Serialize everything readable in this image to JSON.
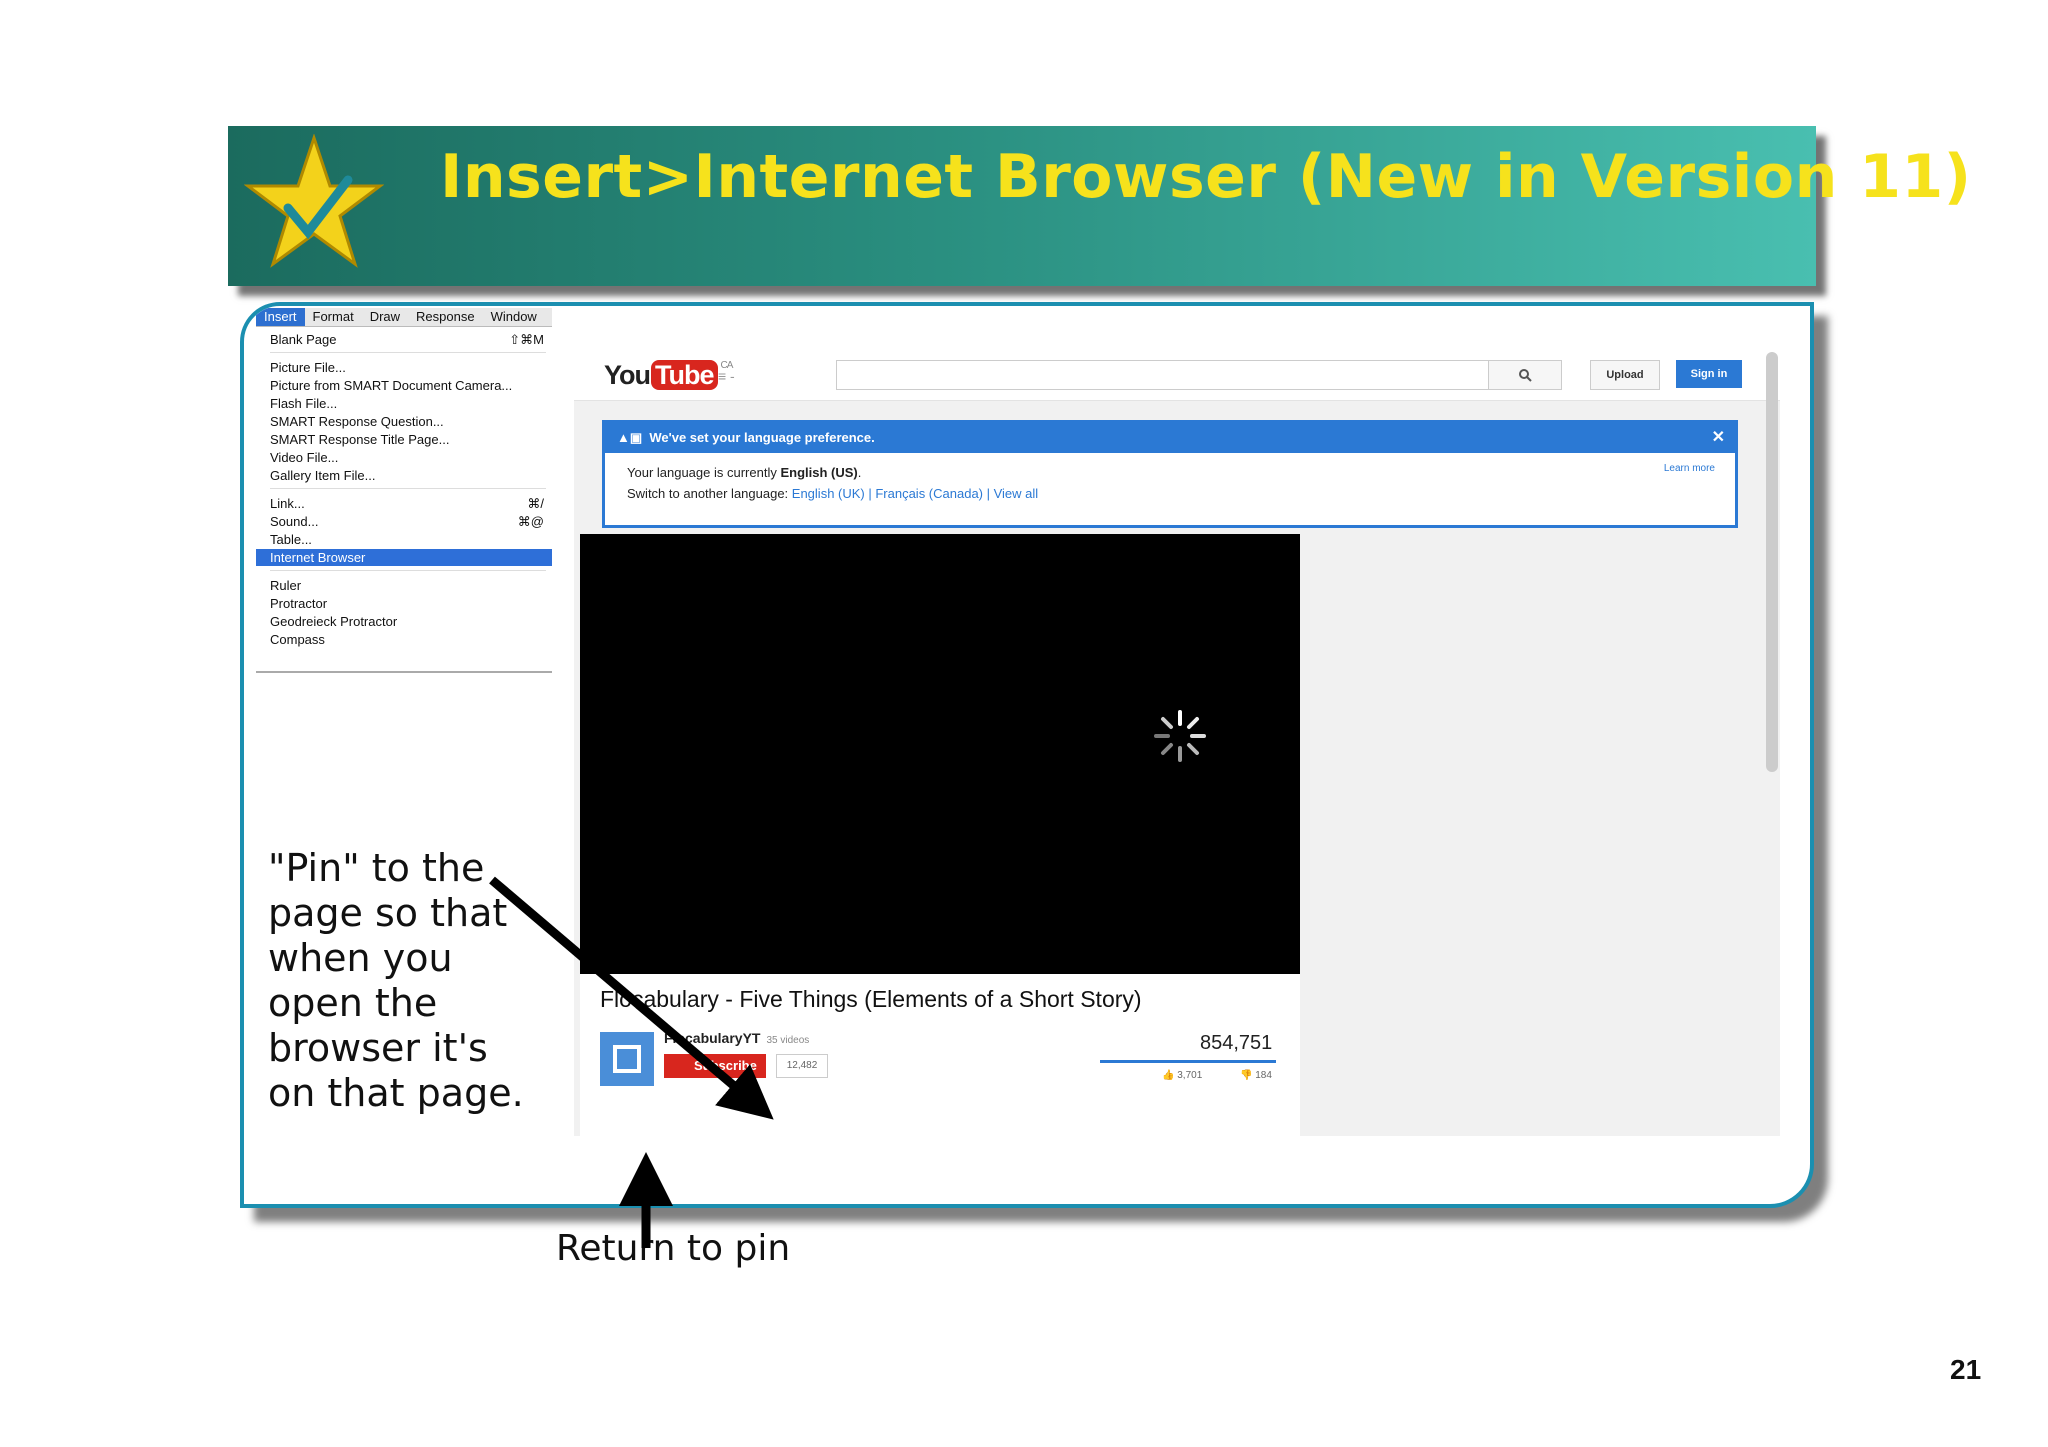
{
  "slide": {
    "title": "Insert>Internet Browser (New in Version 11)",
    "page_number": "21"
  },
  "menu": {
    "bar": [
      "Insert",
      "Format",
      "Draw",
      "Response",
      "Window"
    ],
    "items": {
      "blank_page": "Blank Page",
      "blank_page_sc": "⇧⌘M",
      "picture_file": "Picture File...",
      "picture_camera": "Picture from SMART Document Camera...",
      "flash_file": "Flash File...",
      "response_question": "SMART Response Question...",
      "response_title": "SMART Response Title Page...",
      "video_file": "Video File...",
      "gallery_item": "Gallery Item File...",
      "link": "Link...",
      "link_sc": "⌘/",
      "sound": "Sound...",
      "sound_sc": "⌘@",
      "table": "Table...",
      "internet_browser": "Internet Browser",
      "ruler": "Ruler",
      "protractor": "Protractor",
      "geodreieck": "Geodreieck Protractor",
      "compass": "Compass"
    }
  },
  "youtube": {
    "logo_you": "You",
    "logo_tube": "Tube",
    "logo_region": "CA",
    "guide": "≡ -",
    "upload": "Upload",
    "sign_in": "Sign in",
    "lang_banner_title": "We've set your language preference.",
    "lang_line1_prefix": "Your language is currently ",
    "lang_current": "English (US)",
    "lang_line2_prefix": "Switch to another language: ",
    "lang_options": "English (UK) | Français (Canada) | View all",
    "learn_more": "Learn more",
    "video_title": "Flocabulary - Five Things (Elements of a Short Story)",
    "channel_name": "FlocabularyYT",
    "channel_videos": "35 videos",
    "subscribe": "Subscribe",
    "subscriber_count": "12,482",
    "views": "854,751",
    "likes": "3,701",
    "dislikes": "184"
  },
  "annotations": {
    "pin_note": "\"Pin\" to the page so that when you open the browser it's on that page.",
    "return_note": "Return to pin"
  },
  "colors": {
    "title_yellow": "#f6e21c",
    "banner_teal": "#2a8f80",
    "frame_blue": "#1b8fb0",
    "menu_highlight": "#2e6fd8",
    "youtube_red": "#d8261e",
    "youtube_blue": "#2b79d4"
  }
}
